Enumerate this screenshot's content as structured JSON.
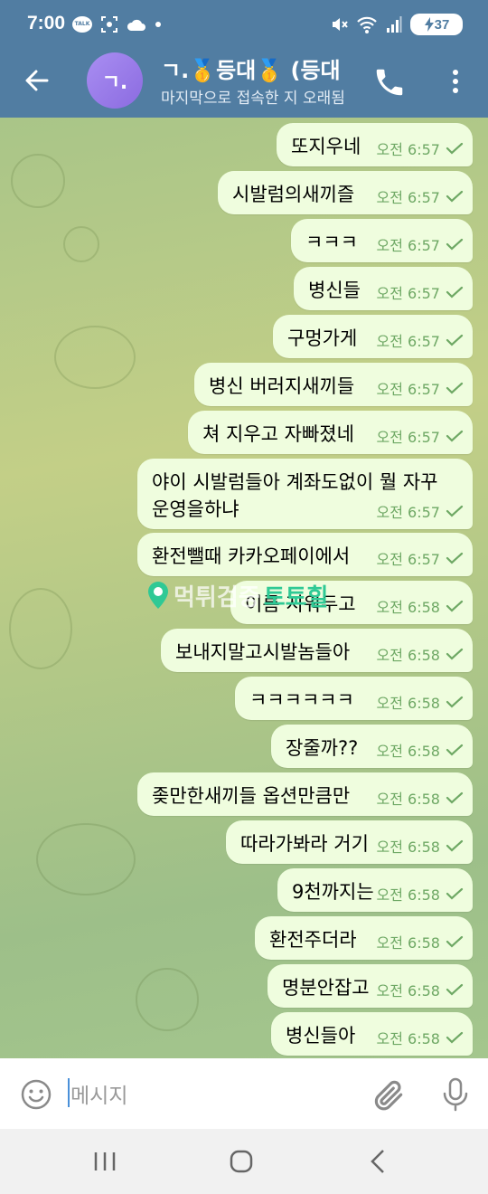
{
  "status_bar": {
    "time": "7:00",
    "talk_badge": "TALK",
    "battery": "37"
  },
  "header": {
    "avatar_initial": "ㄱ.",
    "title": "ㄱ.🥇등대🥇 (등대",
    "subtitle": "마지막으로 접속한 지 오래됨"
  },
  "messages": [
    {
      "text": "또지우네",
      "time": "오전 6:57"
    },
    {
      "text": "시발럼의새끼즐",
      "time": "오전 6:57"
    },
    {
      "text": "ㅋㅋㅋ",
      "time": "오전 6:57"
    },
    {
      "text": "병신들",
      "time": "오전 6:57"
    },
    {
      "text": "구멍가게",
      "time": "오전 6:57"
    },
    {
      "text": "병신 버러지새끼들",
      "time": "오전 6:57"
    },
    {
      "text": "쳐 지우고 자빠졌네",
      "time": "오전 6:57"
    },
    {
      "text": "야이 시발럼들아 계좌도없이 뭘 자꾸",
      "text2": "운영을하냐",
      "time": "오전 6:57"
    },
    {
      "text": "환전뺄때 카카오페이에서",
      "time": "오전 6:57"
    },
    {
      "text": "이름 지워두고",
      "time": "오전 6:58"
    },
    {
      "text": "보내지말고시발놈들아",
      "time": "오전 6:58"
    },
    {
      "text": "ㅋㅋㅋㅋㅋㅋ",
      "time": "오전 6:58"
    },
    {
      "text": "장줄까??",
      "time": "오전 6:58"
    },
    {
      "text": "좆만한새끼들 옵션만큼만",
      "time": "오전 6:58"
    },
    {
      "text": "따라가봐라 거기",
      "time": "오전 6:58"
    },
    {
      "text": "9천까지는",
      "time": "오전 6:58"
    },
    {
      "text": "환전주더라",
      "time": "오전 6:58"
    },
    {
      "text": "명분안잡고",
      "time": "오전 6:58"
    },
    {
      "text": "병신들아",
      "time": "오전 6:58"
    }
  ],
  "watermark": {
    "part1": "먹튀검증",
    "part2": "토토힐"
  },
  "input": {
    "placeholder": "메시지"
  },
  "colors": {
    "header": "#517da2",
    "bubble": "#effdde",
    "meta": "#6ea864",
    "avatar": "#9b7fea"
  }
}
